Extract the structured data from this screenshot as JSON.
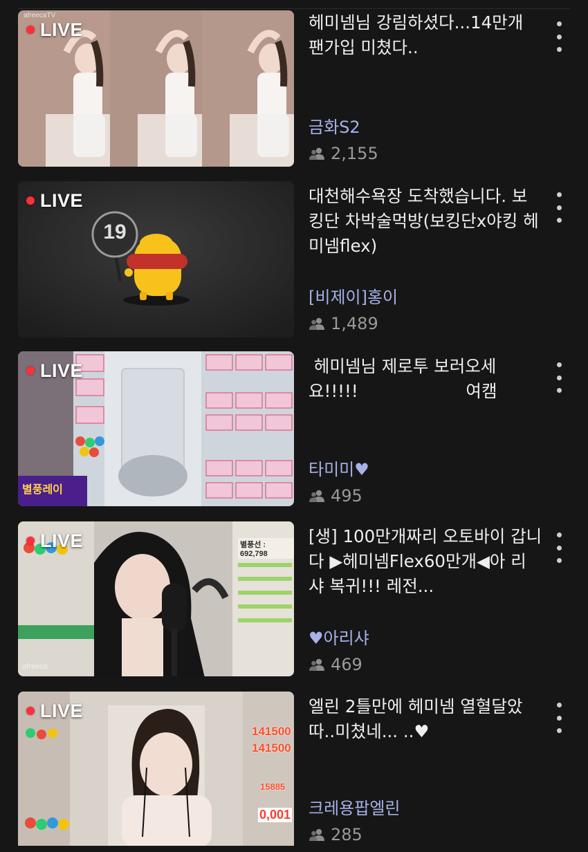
{
  "badge_text": "LIVE",
  "colors": {
    "background": "#161616",
    "live_dot": "#ff2f3a",
    "streamer_name": "#a6b2e8",
    "viewer_count": "#9a9a9a"
  },
  "icons": {
    "more": "more-vertical-icon",
    "viewers": "people-icon"
  },
  "items": [
    {
      "title": "헤미넴님 강림하셨다...14만개 팬가입 미쳤다..",
      "streamer": "금화S2",
      "viewers": "2,155",
      "thumbnail": {
        "logo": "afreecaTV"
      }
    },
    {
      "title": "대천해수욕장 도착했습니다. 보킹단 차박술먹방(보킹단x야킹 헤미넴flex)",
      "streamer": "[비제이]홍이",
      "viewers": "1,489",
      "thumbnail": {
        "age_badge": "19"
      }
    },
    {
      "title": " 헤미넴님 제로투 보러오세요!!!!!                    여캠",
      "streamer": "타미미♥",
      "viewers": "495",
      "thumbnail": {
        "banner": "별풍레이"
      }
    },
    {
      "title": "[생] 100만개짜리 오토바이 갑니다 ▶헤미넴Flex60만개◀아 리 샤 복귀!!! 레전...",
      "streamer": "♥아리샤",
      "viewers": "469",
      "thumbnail": {
        "overlay_label": "별풍선 : 692,798",
        "logo": "afreeca"
      }
    },
    {
      "title": "엘린 2틀만에 헤미넴 열혈달았따..미쳤네... ..♥",
      "streamer": "크레용팝엘린",
      "viewers": "285",
      "thumbnail": {
        "overlay_values": [
          "141500",
          "141500",
          "15885",
          "0,001"
        ]
      }
    }
  ]
}
